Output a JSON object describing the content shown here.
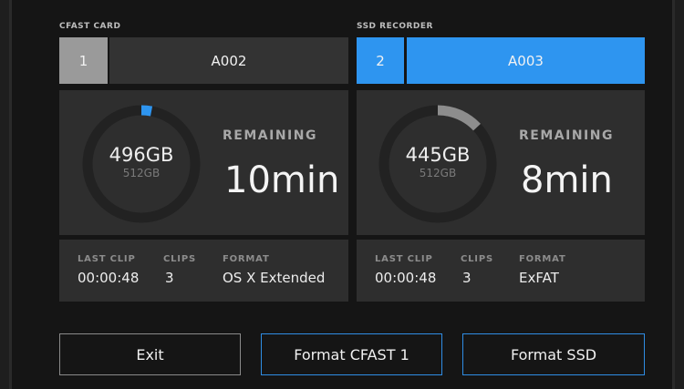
{
  "left": {
    "media_label": "CFAST CARD",
    "slot_number": "1",
    "clip_name": "A002",
    "remaining_capacity": "496GB",
    "total_capacity": "512GB",
    "used_fraction": 0.03,
    "remaining_label": "REMAINING",
    "remaining_time": "10min",
    "last_clip_label": "LAST CLIP",
    "last_clip": "00:00:48",
    "clips_label": "CLIPS",
    "clips": "3",
    "format_label": "FORMAT",
    "format": "OS X Extended"
  },
  "right": {
    "media_label": "SSD RECORDER",
    "slot_number": "2",
    "clip_name": "A003",
    "remaining_capacity": "445GB",
    "total_capacity": "512GB",
    "used_fraction": 0.13,
    "remaining_label": "REMAINING",
    "remaining_time": "8min",
    "last_clip_label": "LAST CLIP",
    "last_clip": "00:00:48",
    "clips_label": "CLIPS",
    "clips": "3",
    "format_label": "FORMAT",
    "format": "ExFAT"
  },
  "buttons": {
    "exit": "Exit",
    "format_cfast": "Format CFAST 1",
    "format_ssd": "Format SSD"
  },
  "colors": {
    "active_blue": "#2e95f0",
    "inactive_gray": "#9a9a9a",
    "ring_track": "#222222",
    "ring_used_gray": "#8d8d8d",
    "button_border_blue": "#2f8de4"
  }
}
